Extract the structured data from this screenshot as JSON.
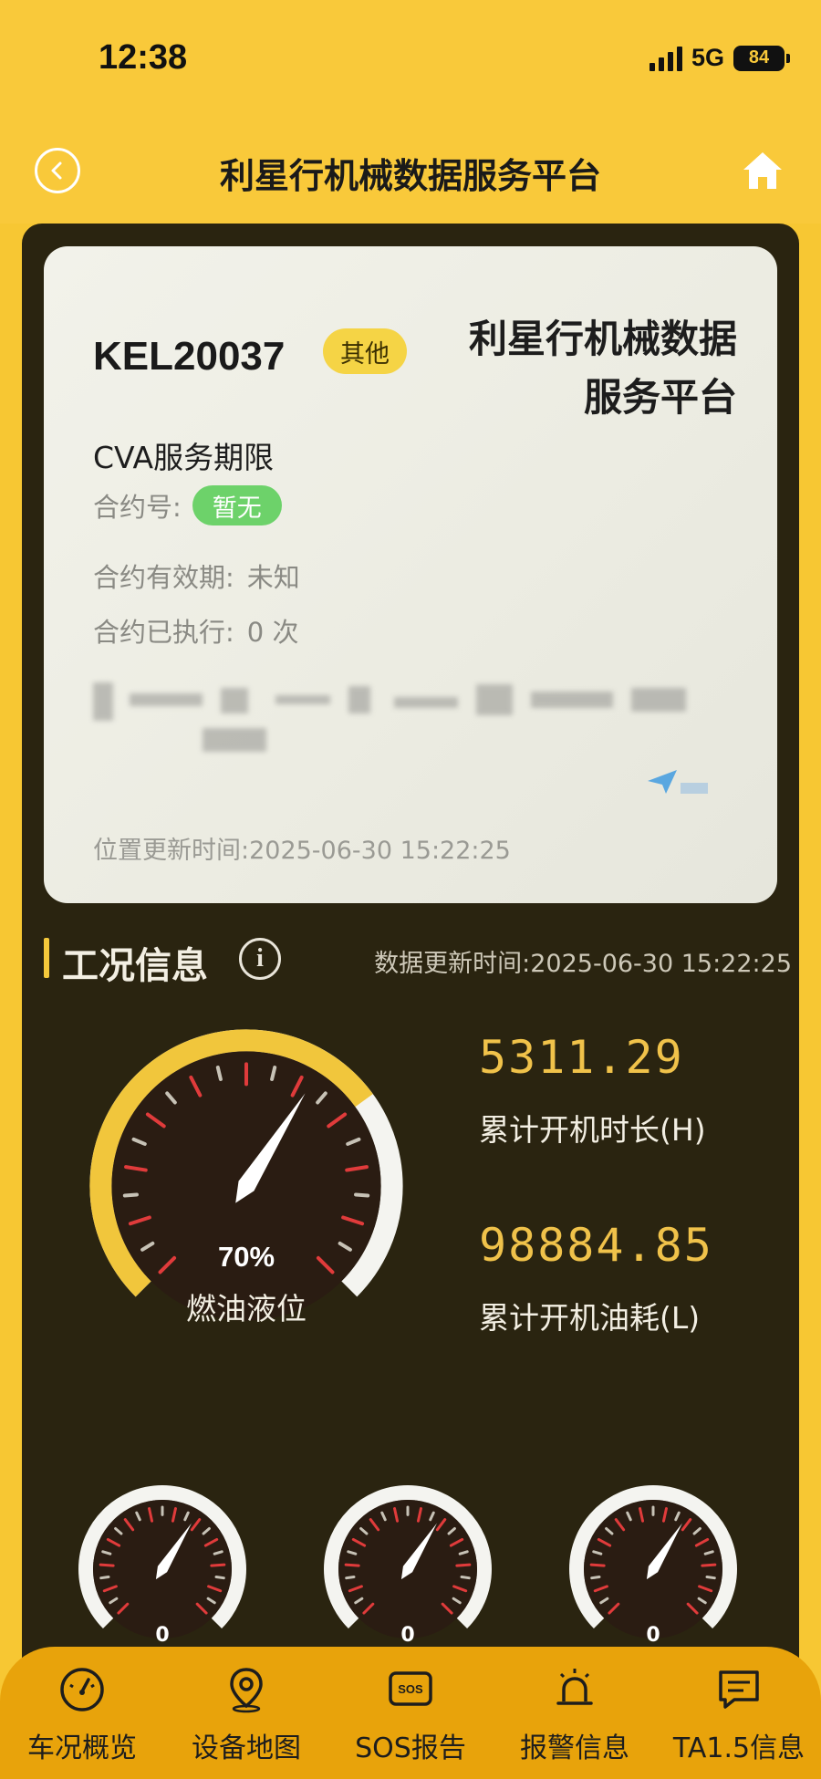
{
  "status_bar": {
    "time": "12:38",
    "network": "5G",
    "battery": "84"
  },
  "nav": {
    "title": "利星行机械数据服务平台",
    "back_icon": "back-icon",
    "home_icon": "home-icon"
  },
  "card": {
    "plate": "KEL20037",
    "type_badge": "其他",
    "brand_line1": "利星行机械数据",
    "brand_line2": "服务平台",
    "cva_title": "CVA服务期限",
    "contract_no_label": "合约号:",
    "contract_no_value": "暂无",
    "validity_label": "合约有效期:",
    "validity_value": "未知",
    "executed_label": "合约已执行:",
    "executed_value": "0 次",
    "position_time": "位置更新时间:2025-06-30 15:22:25"
  },
  "status_section": {
    "title": "工况信息",
    "data_time": "数据更新时间:2025-06-30 15:22:25"
  },
  "fuel_gauge": {
    "percent": 70,
    "value_label": "70%",
    "label": "燃油液位"
  },
  "metrics": [
    {
      "value": "5311.29",
      "label": "累计开机时长(H)"
    },
    {
      "value": "98884.85",
      "label": "累计开机油耗(L)"
    }
  ],
  "small_gauges": [
    {
      "value": "0"
    },
    {
      "value": "0"
    },
    {
      "value": "0"
    }
  ],
  "tabs": [
    {
      "label": "车况概览",
      "icon": "speedometer-icon"
    },
    {
      "label": "设备地图",
      "icon": "location-pin-icon"
    },
    {
      "label": "SOS报告",
      "icon": "sos-icon"
    },
    {
      "label": "报警信息",
      "icon": "alarm-icon"
    },
    {
      "label": "TA1.5信息",
      "icon": "message-icon"
    }
  ],
  "colors": {
    "brand_yellow": "#f9c93a",
    "panel_dark": "#2a2410",
    "accent_gold": "#f0c24a",
    "contract_green": "#6dd26a",
    "tab_bar": "#e8a30b"
  }
}
